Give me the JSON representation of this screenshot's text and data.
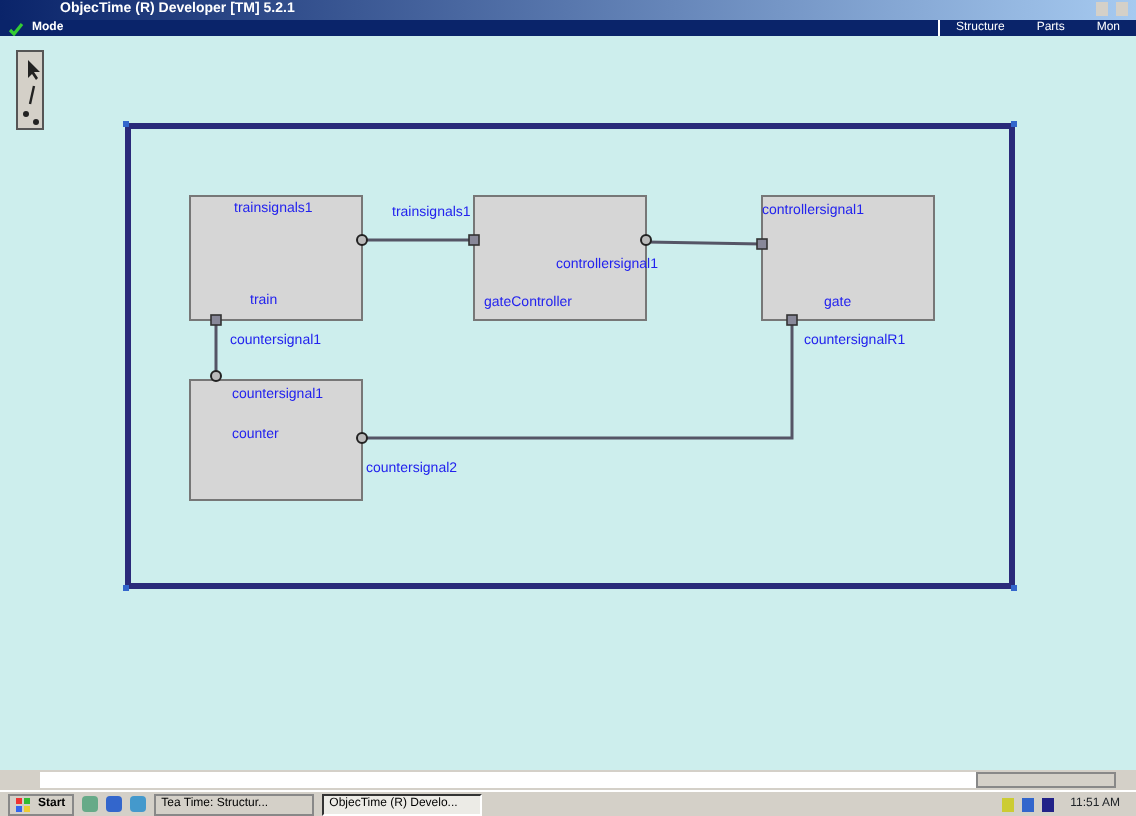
{
  "window": {
    "title": "ObjecTime (R) Developer [TM] 5.2.1"
  },
  "menu_bar": {
    "mode": "Mode",
    "right_items": [
      "Structure",
      "Parts",
      "Mon"
    ]
  },
  "capsules": [
    {
      "name": "train",
      "ports": [
        "trainsignals1",
        "countersignal1"
      ]
    },
    {
      "name": "gateController",
      "ports": [
        "trainsignals1",
        "controllersignal1"
      ]
    },
    {
      "name": "gate",
      "ports": [
        "controllersignal1",
        "countersignalR1"
      ]
    },
    {
      "name": "counter",
      "ports": [
        "countersignal1",
        "countersignal2"
      ]
    }
  ],
  "taskbar": {
    "start": "Start",
    "tasks": [
      {
        "label": "Tea Time: Structur...",
        "selected": false
      },
      {
        "label": "ObjecTime (R) Develo...",
        "selected": true
      }
    ],
    "clock": "11:51 AM"
  }
}
